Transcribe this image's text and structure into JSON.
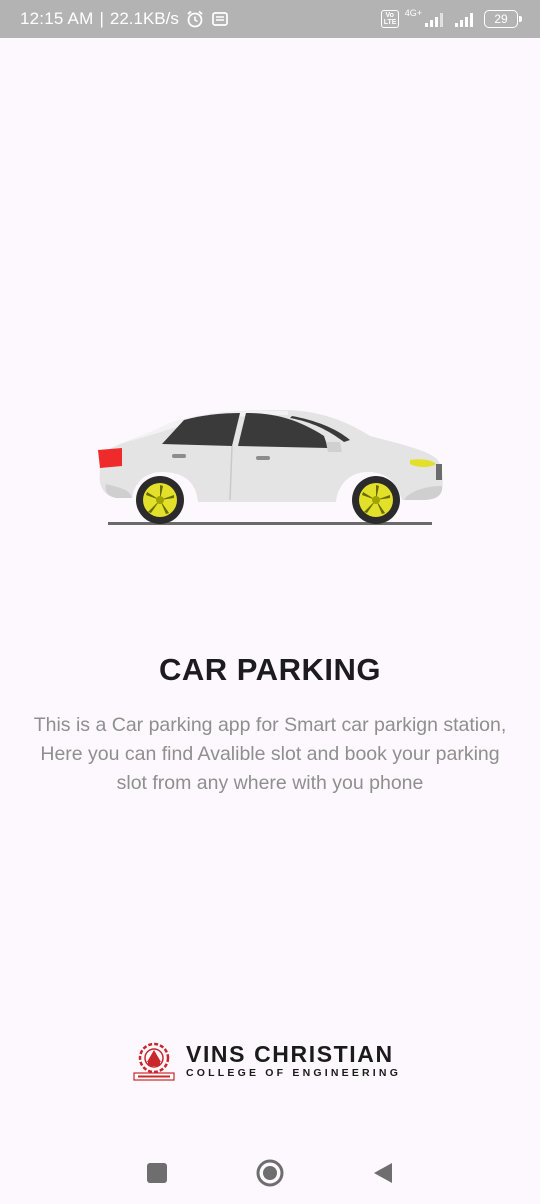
{
  "status_bar": {
    "time": "12:15 AM",
    "separator": "|",
    "speed": "22.1KB/s",
    "icons": [
      "alarm-icon",
      "notification-icon",
      "volte-icon",
      "signal-icon",
      "signal-icon",
      "battery-icon"
    ],
    "volte_top": "Vo",
    "volte_bottom": "LTE",
    "network": "4G+",
    "battery": "29"
  },
  "splash": {
    "illustration": "car-icon",
    "title": "CAR PARKING",
    "description": "This is a Car parking app for Smart car parkign station, Here you can find Avalible slot and book your parking slot from any where with you phone"
  },
  "footer": {
    "logo_main": "VINS CHRISTIAN",
    "logo_sub": "COLLEGE OF ENGINEERING"
  },
  "nav_bar": {
    "icons": [
      "recents-icon",
      "home-icon",
      "back-icon"
    ]
  },
  "colors": {
    "background": "#fdf8fd",
    "status_bar": "#b3b3b3",
    "title": "#1d1b20",
    "description": "#8f8f8f",
    "car_body": "#e4e4e4",
    "wheel_rim": "#e2e02a",
    "tail_light": "#ee2a2a"
  }
}
